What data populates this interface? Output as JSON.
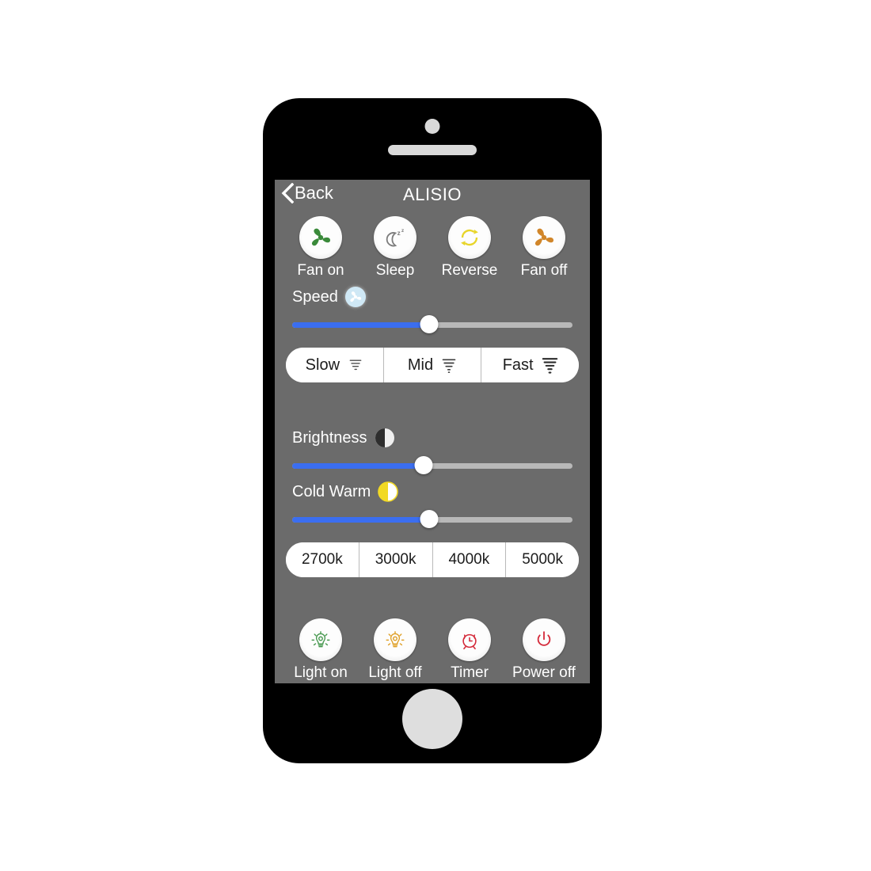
{
  "device": {
    "name": "smartphone-mockup",
    "earpiece_icon": "speaker-bar",
    "camera_icon": "front-camera-dot",
    "home_button_icon": "home-button"
  },
  "navbar": {
    "back_label": "Back",
    "back_icon": "chevron-left-icon",
    "title": "ALISIO"
  },
  "fan_controls": [
    {
      "label": "Fan on",
      "icon": "fan-icon",
      "color": "#3a8a3a"
    },
    {
      "label": "Sleep",
      "icon": "moon-zz-icon",
      "color": "#7d7d7d"
    },
    {
      "label": "Reverse",
      "icon": "refresh-arrows-icon",
      "color": "#e8d52a"
    },
    {
      "label": "Fan off",
      "icon": "fan-icon",
      "color": "#d1862a"
    }
  ],
  "speed": {
    "label": "Speed",
    "badge_icon": "fan-badge-icon",
    "badge_color": "#cfe8f5",
    "value": 49,
    "min": 0,
    "max": 100,
    "fill_color": "#3b6ef0",
    "track_color": "#b8b8b8"
  },
  "speed_presets": [
    {
      "label": "Slow",
      "icon": "wind-small-icon"
    },
    {
      "label": "Mid",
      "icon": "wind-medium-icon"
    },
    {
      "label": "Fast",
      "icon": "wind-large-icon"
    }
  ],
  "brightness": {
    "label": "Brightness",
    "badge_icon": "contrast-half-circle-icon",
    "badge_color": "#e9e9e9",
    "value": 47,
    "min": 0,
    "max": 100,
    "fill_color": "#3b6ef0",
    "track_color": "#b8b8b8"
  },
  "cold_warm": {
    "label": "Cold Warm",
    "badge_icon": "half-moon-warm-icon",
    "badge_color": "#f2d924",
    "value": 49,
    "min": 0,
    "max": 100,
    "fill_color": "#3b6ef0",
    "track_color": "#b8b8b8"
  },
  "color_temperatures": [
    {
      "label": "2700k"
    },
    {
      "label": "3000k"
    },
    {
      "label": "4000k"
    },
    {
      "label": "5000k"
    }
  ],
  "light_controls": [
    {
      "label": "Light on",
      "icon": "lightbulb-icon",
      "color": "#4a9a52"
    },
    {
      "label": "Light off",
      "icon": "lightbulb-icon",
      "color": "#e0a22c"
    },
    {
      "label": "Timer",
      "icon": "alarm-clock-icon",
      "color": "#d42a3a"
    },
    {
      "label": "Power off",
      "icon": "power-icon",
      "color": "#d42a3a"
    }
  ],
  "theme": {
    "screen_background": "#6b6b6b",
    "phone_body": "#000000",
    "text_on_screen": "#ffffff",
    "pill_background": "#ffffff",
    "pill_text": "#1c1c1c"
  }
}
